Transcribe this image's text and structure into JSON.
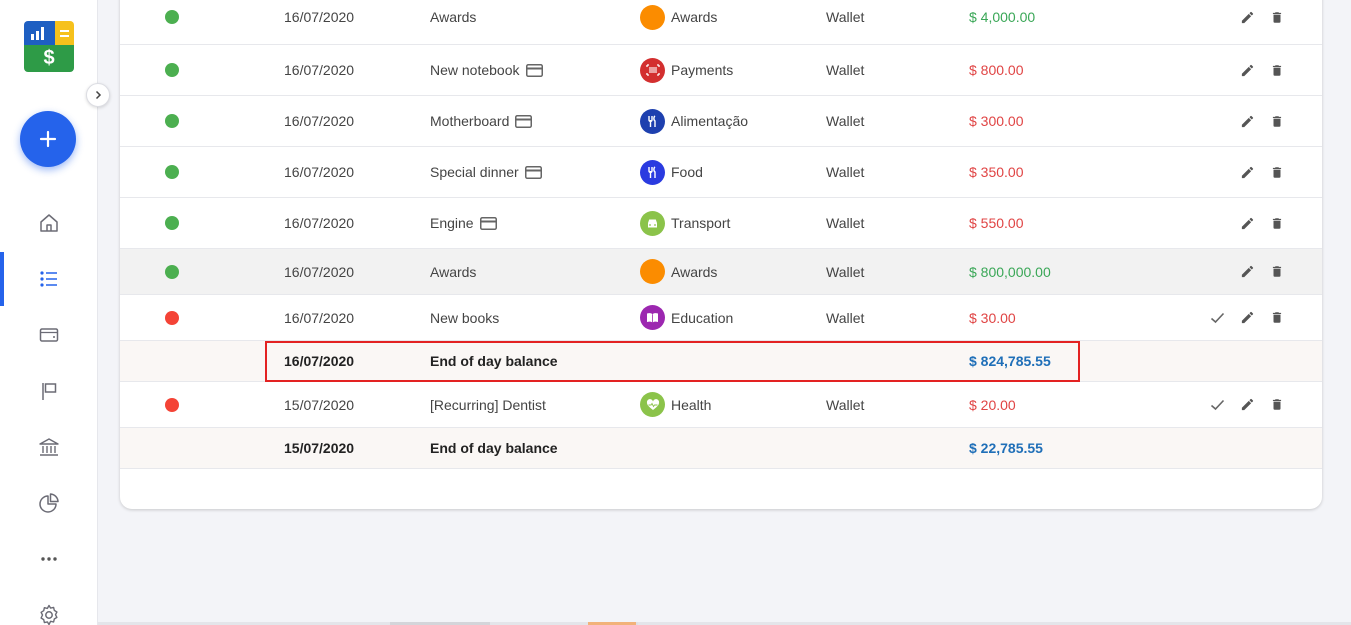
{
  "colors": {
    "accent": "#2563eb",
    "positive": "#3aa757",
    "negative": "#e04444",
    "balance": "#1f6fb8",
    "status_paid": "#4caf50",
    "status_pending": "#f44336",
    "highlight_border": "#e32222"
  },
  "sidebar": {
    "logo_symbol": "$",
    "fab_icon": "plus-icon",
    "nav": [
      {
        "icon": "home-icon",
        "active": false
      },
      {
        "icon": "list-icon",
        "active": true
      },
      {
        "icon": "wallet-icon",
        "active": false
      },
      {
        "icon": "flag-icon",
        "active": false
      },
      {
        "icon": "bank-icon",
        "active": false
      },
      {
        "icon": "pie-chart-icon",
        "active": false
      },
      {
        "icon": "more-icon",
        "active": false
      },
      {
        "icon": "gear-icon",
        "active": false
      }
    ]
  },
  "transactions": [
    {
      "status": "paid",
      "date": "16/07/2020",
      "description": "Awards",
      "card": false,
      "category": "Awards",
      "category_color": "#fb8c00",
      "category_icon": "none",
      "account": "Wallet",
      "amount": "$ 4,000.00",
      "type": "income",
      "confirm": false
    },
    {
      "status": "paid",
      "date": "16/07/2020",
      "description": "New notebook",
      "card": true,
      "category": "Payments",
      "category_color": "#d32f2f",
      "category_icon": "barcode-icon",
      "account": "Wallet",
      "amount": "$ 800.00",
      "type": "expense",
      "confirm": false
    },
    {
      "status": "paid",
      "date": "16/07/2020",
      "description": "Motherboard",
      "card": true,
      "category": "Alimentação",
      "category_color": "#1e40af",
      "category_icon": "cutlery-icon",
      "account": "Wallet",
      "amount": "$ 300.00",
      "type": "expense",
      "confirm": false
    },
    {
      "status": "paid",
      "date": "16/07/2020",
      "description": "Special dinner",
      "card": true,
      "category": "Food",
      "category_color": "#2a3be0",
      "category_icon": "cutlery-icon",
      "account": "Wallet",
      "amount": "$ 350.00",
      "type": "expense",
      "confirm": false
    },
    {
      "status": "paid",
      "date": "16/07/2020",
      "description": "Engine",
      "card": true,
      "category": "Transport",
      "category_color": "#8bc34a",
      "category_icon": "car-icon",
      "account": "Wallet",
      "amount": "$ 550.00",
      "type": "expense",
      "confirm": false
    },
    {
      "status": "paid",
      "date": "16/07/2020",
      "description": "Awards",
      "card": false,
      "category": "Awards",
      "category_color": "#fb8c00",
      "category_icon": "none",
      "account": "Wallet",
      "amount": "$ 800,000.00",
      "type": "income",
      "confirm": false,
      "hover": true
    },
    {
      "status": "pending",
      "date": "16/07/2020",
      "description": "New books",
      "card": false,
      "category": "Education",
      "category_color": "#9c27b0",
      "category_icon": "book-icon",
      "account": "Wallet",
      "amount": "$ 30.00",
      "type": "expense",
      "confirm": true
    }
  ],
  "balance_1": {
    "date": "16/07/2020",
    "label": "End of day balance",
    "amount": "$ 824,785.55"
  },
  "transaction_2": {
    "status": "pending",
    "date": "15/07/2020",
    "description": "[Recurring] Dentist",
    "category": "Health",
    "category_color": "#8bc34a",
    "category_icon": "heart-pulse-icon",
    "account": "Wallet",
    "amount": "$ 20.00",
    "type": "expense",
    "confirm": true
  },
  "balance_2": {
    "date": "15/07/2020",
    "label": "End of day balance",
    "amount": "$ 22,785.55"
  }
}
